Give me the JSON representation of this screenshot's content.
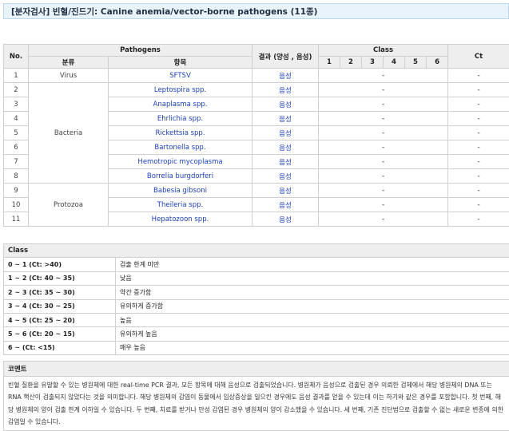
{
  "title": "[분자검사]  빈혈/진드기: Canine anemia/vector-borne pathogens (11종)",
  "main": {
    "headers": {
      "no": "No.",
      "pathogens": "Pathogens",
      "category": "분류",
      "item": "항목",
      "result": "결과 (양성 , 음성)",
      "class": "Class",
      "class_nums": [
        "1",
        "2",
        "3",
        "4",
        "5",
        "6"
      ],
      "ct": "Ct"
    },
    "groups": {
      "virus": "Virus",
      "bacteria": "Bacteria",
      "protozoa": "Protozoa"
    },
    "rows": [
      {
        "no": "1",
        "item": "SFTSV",
        "result": "음성",
        "class": "-",
        "ct": "-"
      },
      {
        "no": "2",
        "item": "Leptospira spp.",
        "result": "음성",
        "class": "-",
        "ct": "-"
      },
      {
        "no": "3",
        "item": "Anaplasma spp.",
        "result": "음성",
        "class": "-",
        "ct": "-"
      },
      {
        "no": "4",
        "item": "Ehrlichia spp.",
        "result": "음성",
        "class": "-",
        "ct": "-"
      },
      {
        "no": "5",
        "item": "Rickettsia spp.",
        "result": "음성",
        "class": "-",
        "ct": "-"
      },
      {
        "no": "6",
        "item": "Bartonella spp.",
        "result": "음성",
        "class": "-",
        "ct": "-"
      },
      {
        "no": "7",
        "item": "Hemotropic mycoplasma",
        "result": "음성",
        "class": "-",
        "ct": "-"
      },
      {
        "no": "8",
        "item": "Borrelia burgdorferi",
        "result": "음성",
        "class": "-",
        "ct": "-"
      },
      {
        "no": "9",
        "item": "Babesia gibsoni",
        "result": "음성",
        "class": "-",
        "ct": "-"
      },
      {
        "no": "10",
        "item": "Theileria spp.",
        "result": "음성",
        "class": "-",
        "ct": "-"
      },
      {
        "no": "11",
        "item": "Hepatozoon spp.",
        "result": "음성",
        "class": "-",
        "ct": "-"
      }
    ]
  },
  "class_table": {
    "header": "Class",
    "rows": [
      {
        "range": "0 ~ 1 (Ct: >40)",
        "desc": "검출 한계 미만"
      },
      {
        "range": "1 ~ 2 (Ct: 40 ~ 35)",
        "desc": "낮음"
      },
      {
        "range": "2 ~ 3 (Ct: 35 ~ 30)",
        "desc": "약간 증가함"
      },
      {
        "range": "3 ~ 4 (Ct: 30 ~ 25)",
        "desc": "유의하게 증가함"
      },
      {
        "range": "4 ~ 5 (Ct: 25 ~ 20)",
        "desc": "높음"
      },
      {
        "range": "5 ~ 6 (Ct: 20 ~ 15)",
        "desc": "유의하게 높음"
      },
      {
        "range": "6 ~ (Ct: <15)",
        "desc": "매우 높음"
      }
    ]
  },
  "comment": {
    "header": "코멘트",
    "text": "빈혈 질환을 유발할 수 있는 병원체에 대한 real-time PCR 결과, 모든 항목에 대해 음성으로 검출되었습니다. 병원체가 음성으로 검출된 경우 의뢰한 검체에서 해당 병원체의 DNA 또는 RNA 핵산이 검출되지 않았다는 것을 의미합니다. 해당 병원체의 감염이 동물에서 임상증상을 일으킨 경우에도 음성 결과를 얻을 수 있는데 이는 하기와 같은 경우를 포함합니다. 첫 번째, 해당 병원체의 양이 검출 한계 이하일 수 있습니다. 두 번째, 치료를 받거나 만성 감염된 경우 병원체의 양이 감소했을 수 있습니다. 세 번째, 기존 진단법으로 검출할 수 없는 새로운 변종에 의한 감염일 수 있습니다."
  }
}
